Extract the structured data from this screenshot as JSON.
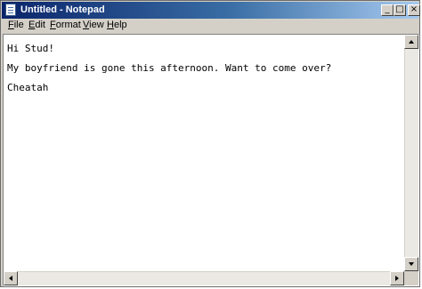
{
  "window": {
    "title": "Untitled - Notepad"
  },
  "caption_buttons": {
    "minimize": "_",
    "maximize": "□",
    "close": "×"
  },
  "menu": [
    {
      "label": "File",
      "accel": "F",
      "rest": "ile"
    },
    {
      "label": "Edit",
      "accel": "E",
      "rest": "dit"
    },
    {
      "label": "Format",
      "accel": "F",
      "rest": "ormat"
    },
    {
      "label": "View",
      "accel": "V",
      "rest": "iew"
    },
    {
      "label": "Help",
      "accel": "H",
      "rest": "elp"
    }
  ],
  "document": {
    "lines": [
      "Hi Stud!",
      "My boyfriend is gone this afternoon. Want to come over?",
      "Cheatah"
    ]
  },
  "icons": {
    "app": "notepad-icon",
    "scroll_up": "arrow-up-icon",
    "scroll_down": "arrow-down-icon",
    "scroll_left": "arrow-left-icon",
    "scroll_right": "arrow-right-icon"
  },
  "colors": {
    "titlebar_start": "#0a246a",
    "titlebar_end": "#a6caf0",
    "chrome": "#d4d0c8"
  }
}
